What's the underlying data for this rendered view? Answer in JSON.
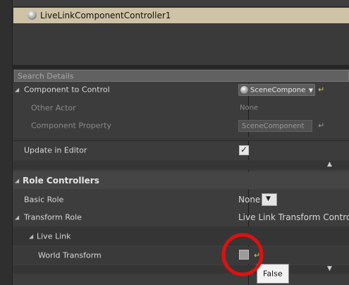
{
  "outliner": {
    "component_name": "LiveLinkComponentController1"
  },
  "search": {
    "placeholder": "Search Details"
  },
  "details": {
    "component_to_control": {
      "label": "Component to Control",
      "value": "SceneCompone"
    },
    "other_actor": {
      "label": "Other Actor",
      "value": "None"
    },
    "component_property": {
      "label": "Component Property",
      "value": "SceneComponent"
    },
    "update_in_editor": {
      "label": "Update in Editor",
      "checked": true
    }
  },
  "role_controllers": {
    "header": "Role Controllers",
    "basic_role": {
      "label": "Basic Role",
      "value": "None"
    },
    "transform_role": {
      "label": "Transform Role",
      "value": "Live Link Transform Controlle"
    },
    "live_link": {
      "label": "Live Link"
    },
    "world_transform": {
      "label": "World Transform",
      "checked": false
    }
  },
  "tooltip": {
    "text": "False"
  },
  "colors": {
    "selected_row": "#cfc3a7",
    "highlight_circle": "#e01010",
    "reset_arrow": "#d8c84a"
  }
}
